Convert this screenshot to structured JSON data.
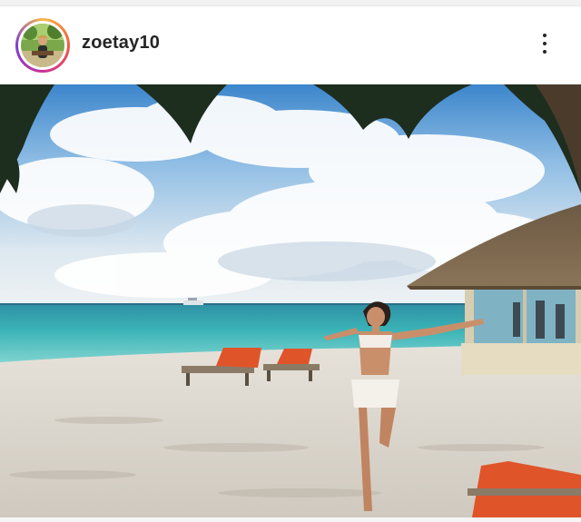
{
  "post": {
    "username": "zoetay10",
    "avatar_icon": "profile-photo",
    "more_icon": "more-options-icon"
  },
  "colors": {
    "username": "#262626",
    "story_ring": [
      "#f8b94a",
      "#f15a3f",
      "#c9319b",
      "#7d3bd1"
    ]
  }
}
